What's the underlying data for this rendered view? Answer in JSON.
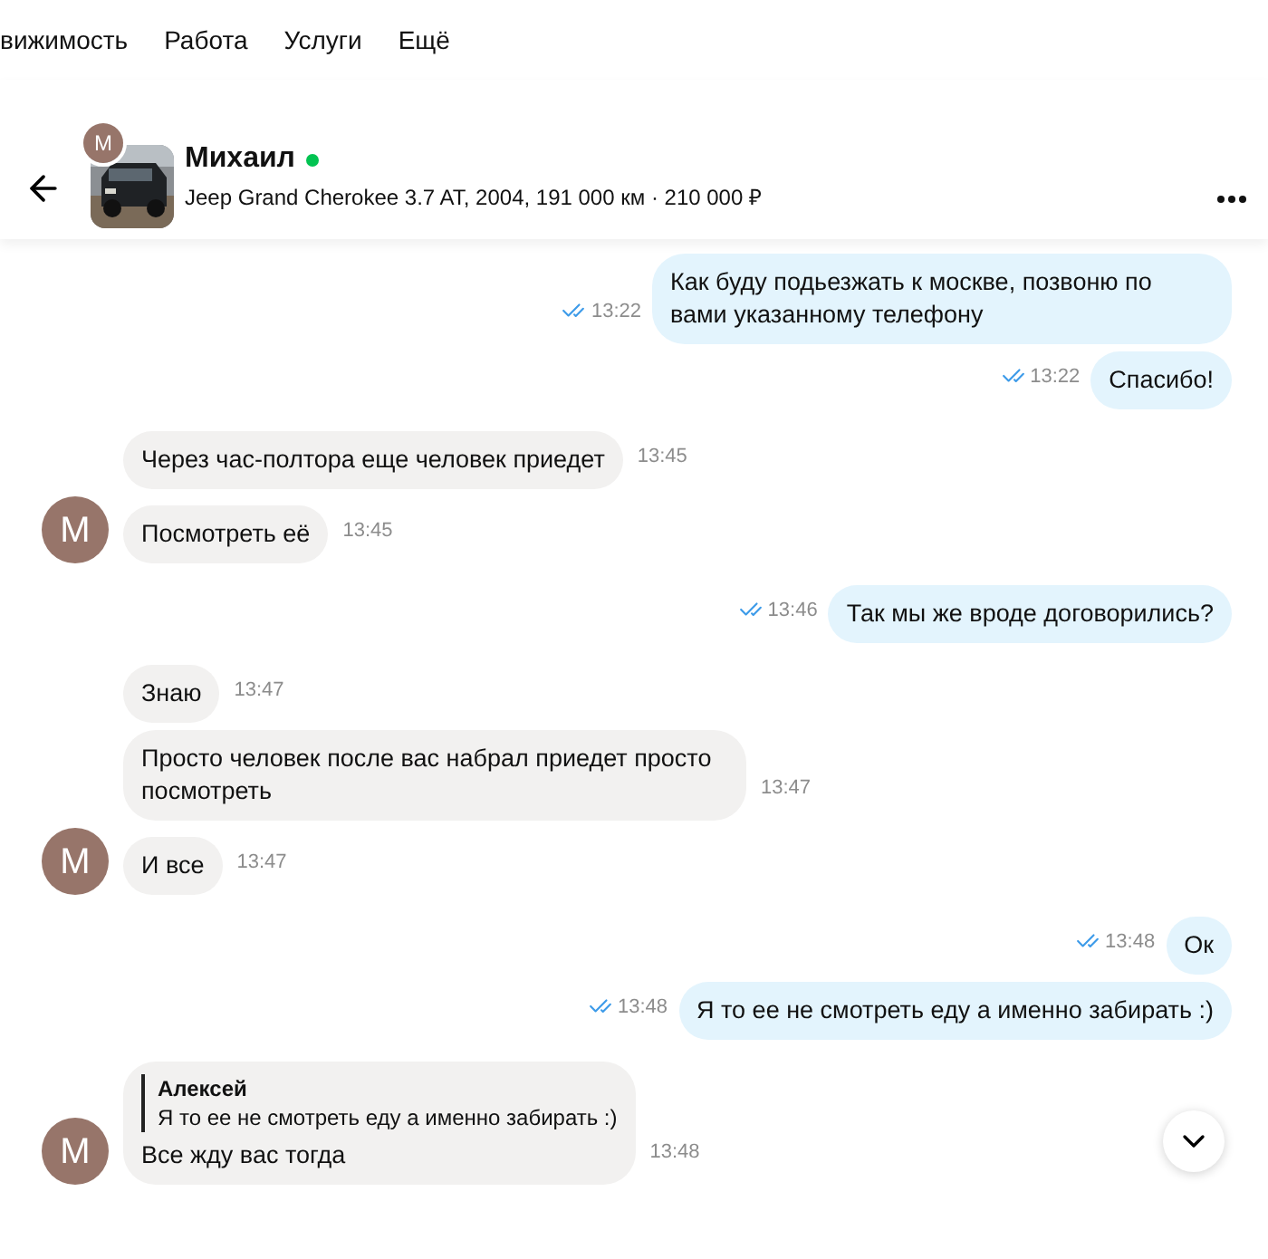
{
  "nav": [
    "вижимость",
    "Работа",
    "Услуги",
    "Ещё"
  ],
  "header": {
    "avatar_letter": "М",
    "name": "Михаил",
    "online": true,
    "subtitle": "Jeep Grand Cherokee 3.7 AT, 2004, 191 000 км · 210 000 ₽"
  },
  "messages": [
    {
      "kind": "out",
      "text": "Как буду подьезжать к москве, позвоню по вами указанному телефону",
      "time": "13:22",
      "read": true
    },
    {
      "kind": "out",
      "text": "Спасибо!",
      "time": "13:22",
      "read": true
    },
    {
      "kind": "in",
      "text": "Через час-полтора еще человек приедет",
      "time": "13:45"
    },
    {
      "kind": "in",
      "text": "Посмотреть её",
      "time": "13:45",
      "avatar_letter": "М"
    },
    {
      "kind": "out",
      "text": "Так мы же вроде договорились?",
      "time": "13:46",
      "read": true
    },
    {
      "kind": "in",
      "text": "Знаю",
      "time": "13:47"
    },
    {
      "kind": "in",
      "text": "Просто человек после вас набрал приедет просто посмотреть",
      "time": "13:47"
    },
    {
      "kind": "in",
      "text": "И все",
      "time": "13:47",
      "avatar_letter": "М"
    },
    {
      "kind": "out",
      "text": "Ок",
      "time": "13:48",
      "read": true
    },
    {
      "kind": "out",
      "text": "Я то ее не смотреть еду а именно забирать :)",
      "time": "13:48",
      "read": true
    },
    {
      "kind": "in",
      "quote": {
        "author": "Алексей",
        "text": "Я то ее не смотреть еду а именно забирать :)"
      },
      "text": "Все жду вас тогда",
      "time": "13:48",
      "avatar_letter": "М"
    }
  ]
}
